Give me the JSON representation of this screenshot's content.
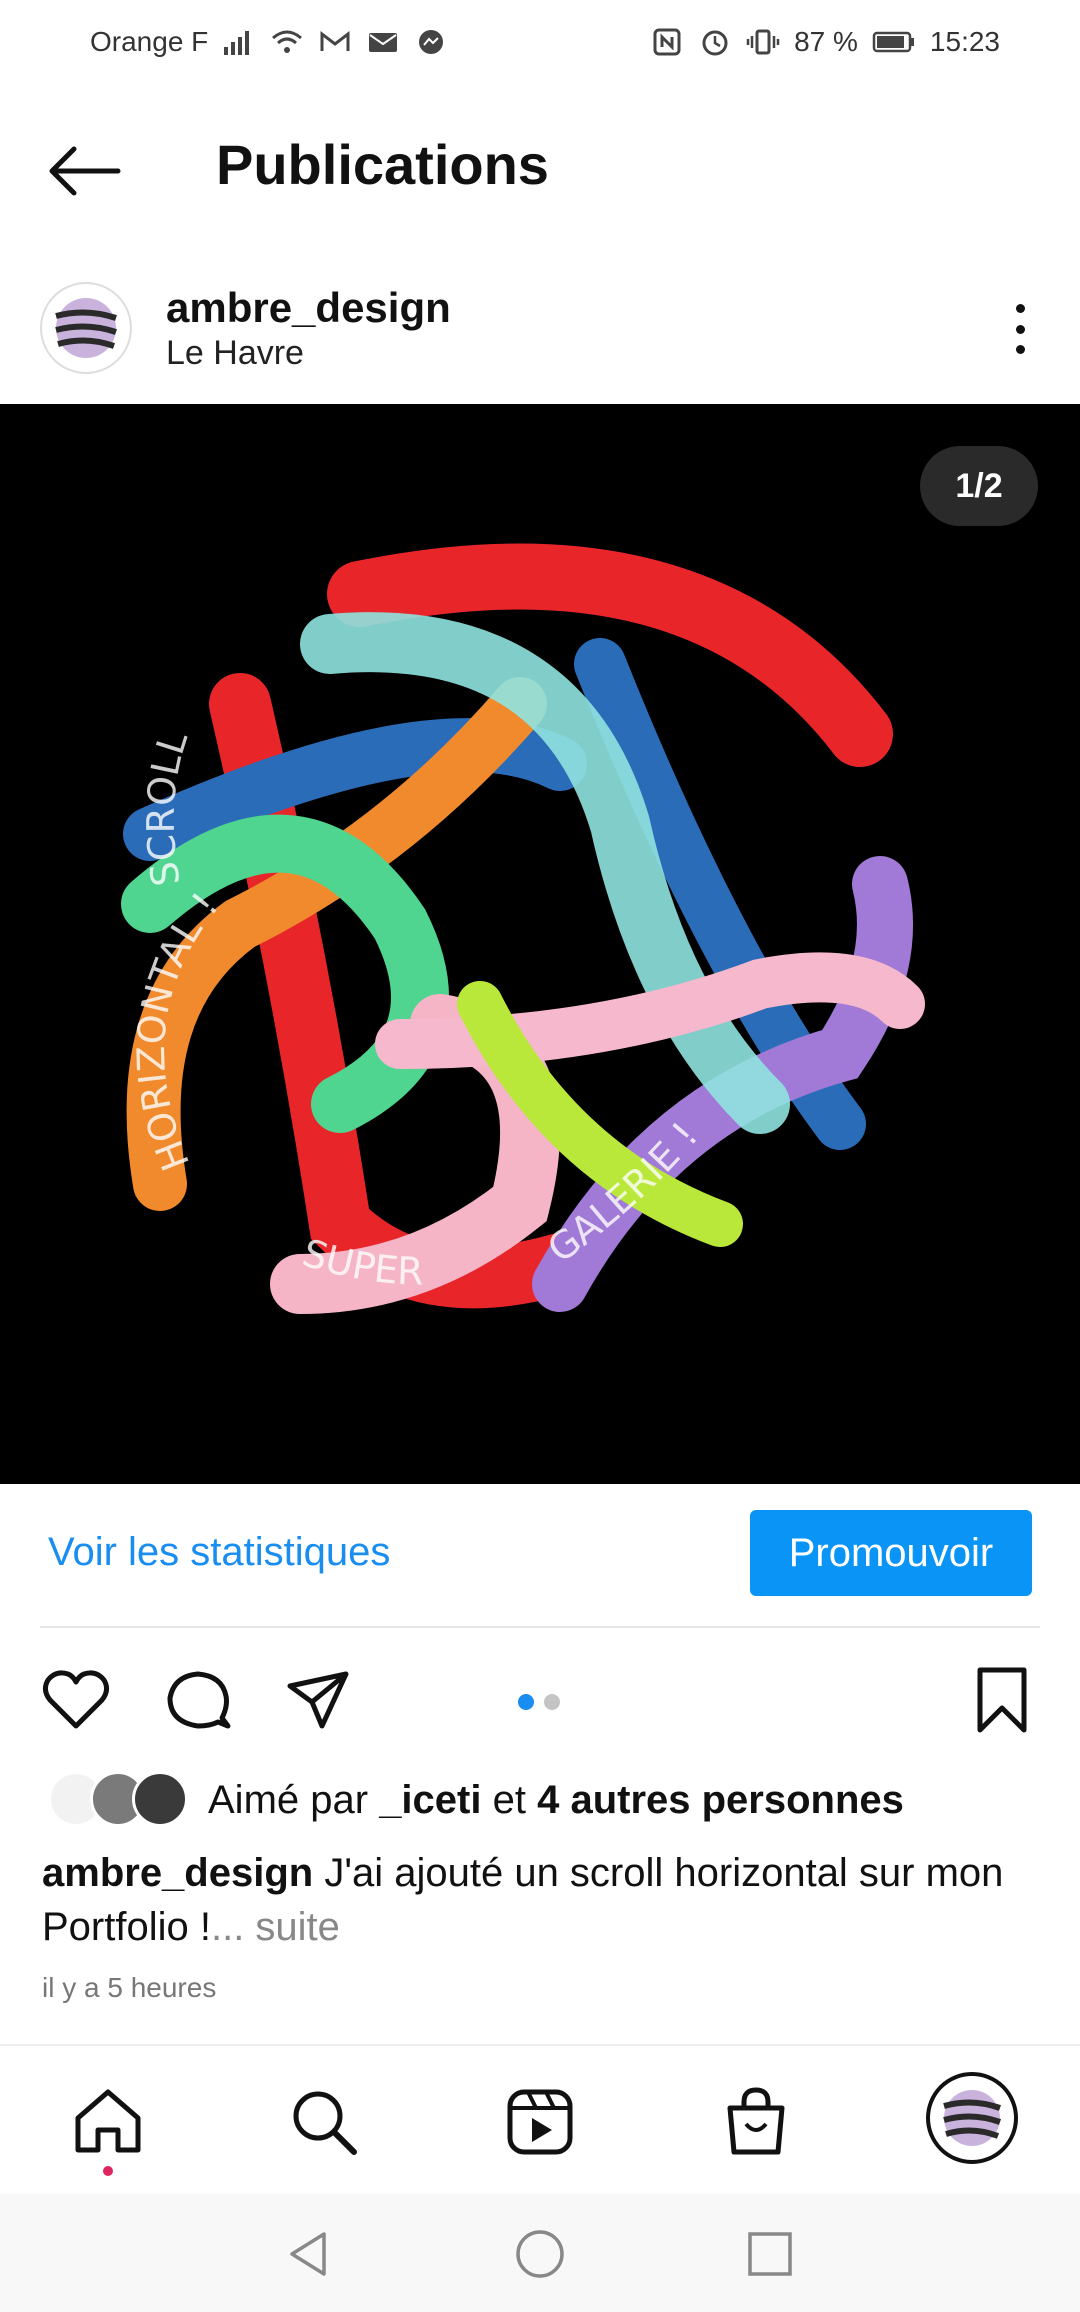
{
  "status_bar": {
    "carrier": "Orange F",
    "battery": "87 %",
    "time": "15:23"
  },
  "header": {
    "title": "Publications"
  },
  "post": {
    "username": "ambre_design",
    "location": "Le Havre",
    "page_indicator": "1/2",
    "artwork_words": [
      "SCROLL",
      "HORIZONTAL !",
      "SUPER",
      "GALERIE !"
    ]
  },
  "stats": {
    "link_label": "Voir les statistiques",
    "promote_label": "Promouvoir"
  },
  "likes": {
    "prefix": "Aimé par",
    "user": "_iceti",
    "connector": "et",
    "others": "4 autres personnes"
  },
  "caption": {
    "username": "ambre_design",
    "text": "J'ai ajouté un scroll horizontal sur mon Portfolio !",
    "more": "... suite"
  },
  "timestamp": "il y a 5 heures",
  "colors": {
    "accent": "#1a8ef0",
    "promote_bg": "#0a95f6",
    "image_bg": "#000000"
  }
}
